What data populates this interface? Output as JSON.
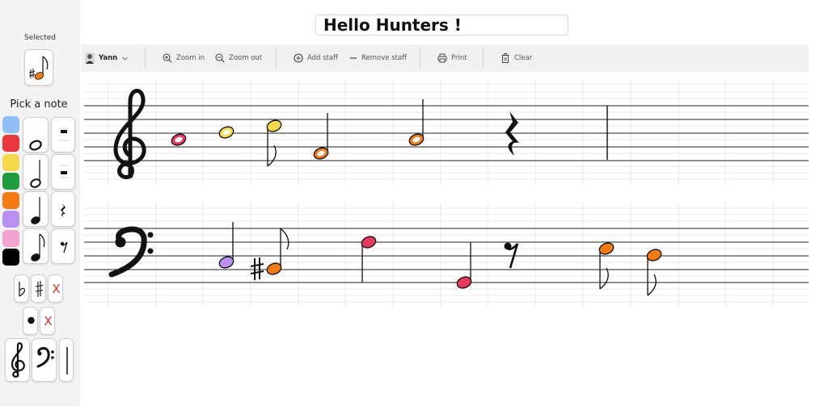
{
  "sidebar": {
    "selected_label": "Selected",
    "pick_label": "Pick a note",
    "colors": [
      "#8fbdf5",
      "#e8383d",
      "#f5d94b",
      "#1f9c3e",
      "#f47a12",
      "#b98ff2",
      "#f2a3cf",
      "#000000"
    ]
  },
  "score": {
    "title": "Hello Hunters !"
  },
  "toolbar": {
    "user": "Yann",
    "zoom_in": "Zoom in",
    "zoom_out": "Zoom out",
    "add_staff": "Add staff",
    "remove_staff": "Remove staff",
    "print": "Print",
    "clear": "Clear"
  },
  "clear_symbol": "X",
  "note_colors": {
    "red": "#e8385e",
    "yellow": "#f5d94b",
    "orange": "#f47a12",
    "purple": "#b98ff2",
    "black": "#111111"
  }
}
